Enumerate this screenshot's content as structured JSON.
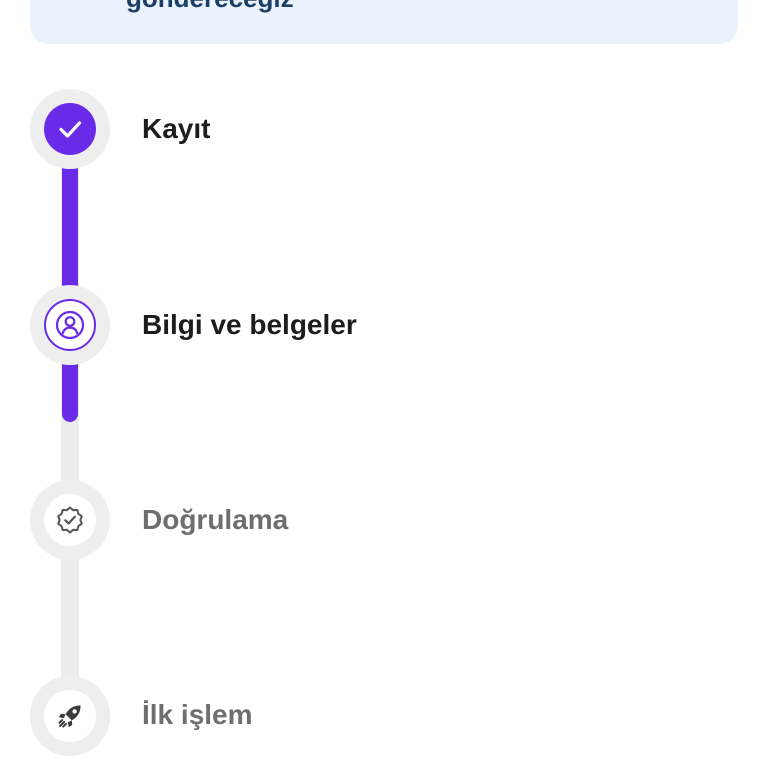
{
  "banner": {
    "text": "göndereceğiz"
  },
  "steps": [
    {
      "label": "Kayıt",
      "state": "completed",
      "icon": "check-icon"
    },
    {
      "label": "Bilgi ve belgeler",
      "state": "active",
      "icon": "user-icon"
    },
    {
      "label": "Doğrulama",
      "state": "pending",
      "icon": "verified-badge-icon"
    },
    {
      "label": "İlk işlem",
      "state": "pending",
      "icon": "rocket-icon"
    }
  ],
  "colors": {
    "accent": "#6a2be8",
    "banner_bg": "#eaf2fd",
    "banner_text": "#1d3f66",
    "track": "#ececec",
    "label_active": "#1d1d1d",
    "label_pending": "#6e6e6e"
  },
  "progress": {
    "completed_steps": 2,
    "total_steps": 4
  }
}
